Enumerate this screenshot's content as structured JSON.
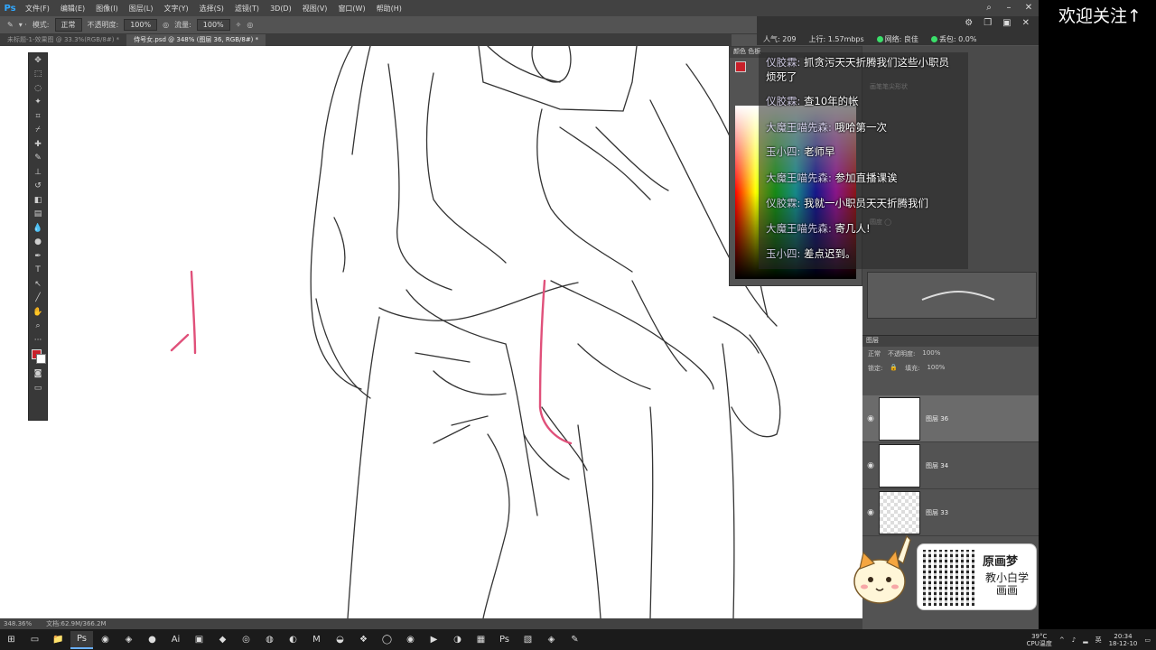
{
  "menubar": {
    "logo": "Ps",
    "items": [
      "文件(F)",
      "编辑(E)",
      "图像(I)",
      "图层(L)",
      "文字(Y)",
      "选择(S)",
      "滤镜(T)",
      "3D(D)",
      "视图(V)",
      "窗口(W)",
      "帮助(H)"
    ]
  },
  "options": {
    "mode_label": "模式:",
    "mode_value": "正常",
    "opacity_label": "不透明度:",
    "opacity_value": "100%",
    "flow_label": "流量:",
    "flow_value": "100%"
  },
  "tabs": [
    {
      "label": "未标题-1-效果图 @ 33.3%(RGB/8#) *"
    },
    {
      "label": "侍号女.psd @ 348% (图层 36, RGB/8#) *"
    }
  ],
  "stream": {
    "popularity": "人气: 209",
    "upload": "上行: 1.57mbps",
    "network": "网络: 良佳",
    "loss": "丢包: 0.0%"
  },
  "chat": [
    {
      "user": "仪胶霖:",
      "text": "抓贪污天天折腾我们这些小职员"
    },
    {
      "user": "",
      "text": "烦死了"
    },
    {
      "user": "仪胶霖:",
      "text": "查10年的帐"
    },
    {
      "user": "大魔王喵先森:",
      "text": "哦哈第一次"
    },
    {
      "user": "玉小四:",
      "text": "老师早"
    },
    {
      "user": "大魔王喵先森:",
      "text": "参加直播课诶"
    },
    {
      "user": "仪胶霖:",
      "text": "我就一小职员天天折腾我们"
    },
    {
      "user": "大魔王喵先森:",
      "text": "寄几人!"
    },
    {
      "user": "玉小四:",
      "text": "差点迟到。"
    }
  ],
  "layers": {
    "header": "图层",
    "blend_value": "正常",
    "opacity_label": "不透明度:",
    "opacity_value": "100%",
    "lock_label": "锁定:",
    "fill_label": "填充:",
    "fill_value": "100%",
    "items": [
      {
        "name": "图层 36"
      },
      {
        "name": "图层 34"
      },
      {
        "name": "图层 33"
      }
    ]
  },
  "status": {
    "zoom": "348.36%",
    "doc": "文档:62.9M/366.2M"
  },
  "overlay": {
    "follow_text": "欢迎关注↑",
    "brand": "原画梦",
    "slogan": "教小白学画画"
  },
  "tray": {
    "temp": "39°C",
    "cpu": "CPU温度",
    "lang": "英",
    "time": "20:34",
    "date": "18-12-10"
  },
  "colors": {
    "foreground": "#c8202a",
    "canvas": "#ffffff",
    "panel": "#535353"
  }
}
